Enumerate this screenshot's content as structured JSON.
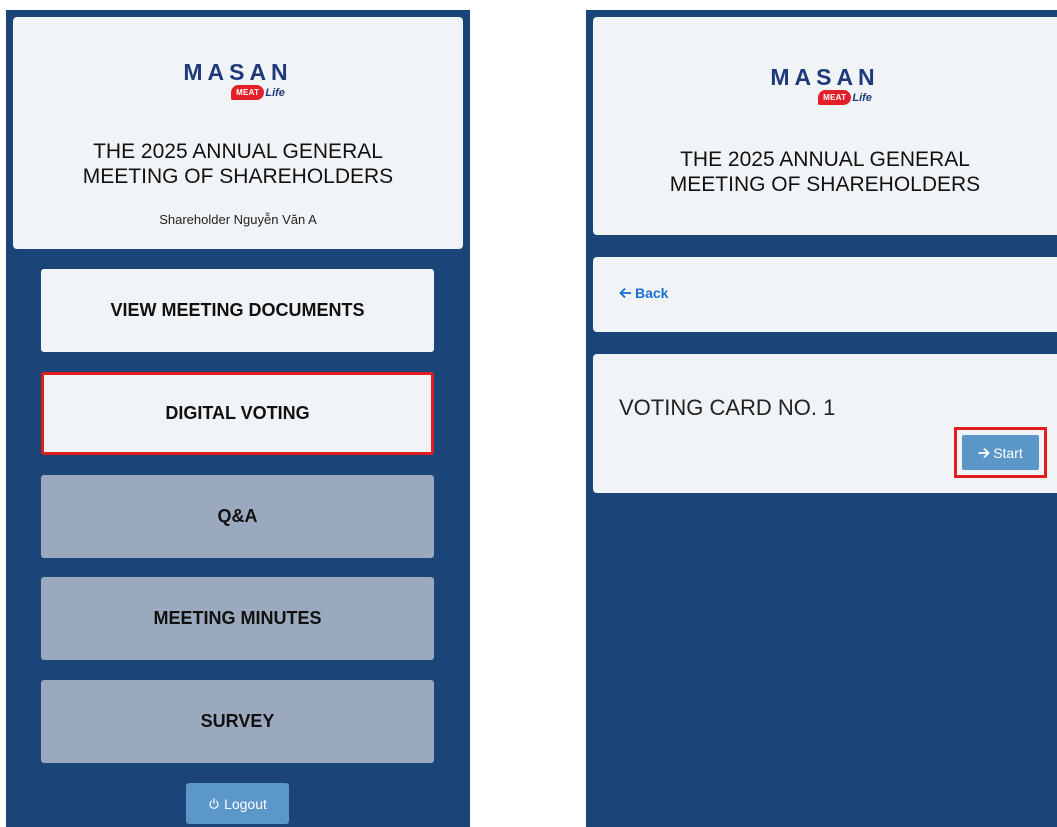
{
  "brand": {
    "name": "MASAN",
    "sub_badge": "MEAT",
    "sub_text": "Life"
  },
  "meeting": {
    "title_line1": "THE 2025 ANNUAL GENERAL",
    "title_line2": "MEETING OF SHAREHOLDERS",
    "shareholder": "Shareholder Nguyễn Văn A"
  },
  "menu": {
    "items": [
      {
        "label": "VIEW MEETING DOCUMENTS",
        "state": "active"
      },
      {
        "label": "DIGITAL VOTING",
        "state": "active-highlighted"
      },
      {
        "label": "Q&A",
        "state": "disabled"
      },
      {
        "label": "MEETING MINUTES",
        "state": "disabled"
      },
      {
        "label": "SURVEY",
        "state": "disabled"
      }
    ],
    "logout_label": "Logout"
  },
  "voting": {
    "back_label": "Back",
    "card_title": "VOTING CARD NO. 1",
    "start_label": "Start"
  },
  "colors": {
    "panel_bg": "#1b4578",
    "card_bg": "#f1f4f7",
    "disabled_btn": "#9aa9bd",
    "highlight": "#e01e1e",
    "primary_btn": "#5a97c8",
    "link": "#1a6fd6",
    "brand_red": "#e3202a",
    "brand_blue": "#1f3a7a"
  },
  "icons": {
    "logout": "power-icon",
    "back": "arrow-left-icon",
    "start": "arrow-right-icon"
  }
}
